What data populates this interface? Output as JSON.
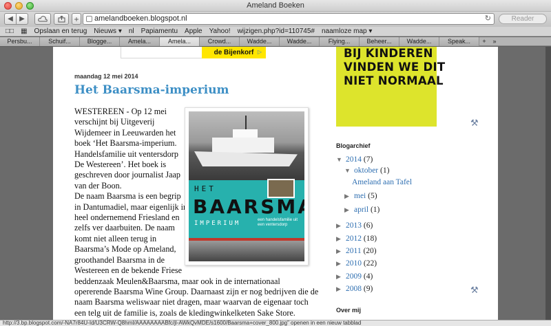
{
  "window": {
    "title": "Ameland Boeken"
  },
  "toolbar": {
    "back_icon": "◀",
    "forward_icon": "▶",
    "add_icon": "+",
    "url": "amelandboeken.blogspot.nl",
    "reload_icon": "↻",
    "reader_label": "Reader"
  },
  "bookmarks": {
    "items": [
      "Opslaan en terug",
      "Nieuws ▾",
      "nl",
      "Papiamentu",
      "Apple",
      "Yahoo!",
      "wijzigen.php?id=110745#",
      "naamloze map ▾"
    ]
  },
  "tabs": {
    "items": [
      "Persbu...",
      "Schuif...",
      "Blogge...",
      "Amela...",
      "Amela...",
      "Crowd...",
      "Wadde...",
      "Wadde...",
      "Flying...",
      "Beheer...",
      "Wadde...",
      "Speak..."
    ],
    "active_index": 4
  },
  "ad_top": {
    "brand": "de Bijenkorf",
    "choice_icon": "▷"
  },
  "post": {
    "date": "maandag 12 mei 2014",
    "title": "Het Baarsma-imperium",
    "paragraph1": "WESTEREEN - Op 12 mei verschijnt bij Uitgeverij Wijdemeer in Leeuwarden het boek ‘Het Baarsma-imperium. Handelsfamilie uit ventersdorp De Westereen’. Het boek is geschreven door journalist Jaap van der Boon.",
    "paragraph2": "De naam Baarsma is een begrip in Dantumadiel, maar eigenlijk in heel ondernemend Friesland en zelfs ver daarbuiten. De naam komt niet alleen terug in Baarsma’s Mode op Ameland, groothandel Baarsma in de Westereen en de bekende Friese beddenzaak Meulen&Baarsma, maar ook in de internationaal opererende Baarsma Wine Group. Daarnaast zijn er nog bedrijven die de naam Baarsma weliswaar niet dragen, maar waarvan de eigenaar toch een telg uit de familie is, zoals de kledingwinkelketen Sake Store."
  },
  "book_cover": {
    "het": "HET",
    "name": "BAARSMA",
    "imperium": "IMPERIUM",
    "subtitle": "een handelsfamilie uit een ventersdorp"
  },
  "sidebar": {
    "ad_lines": [
      "BIJ KINDEREN",
      "VINDEN WE DIT",
      "NIET NORMAAL"
    ],
    "archive_title": "Blogarchief",
    "archive": {
      "y2014": {
        "label": "2014",
        "count": "(7)"
      },
      "oktober": {
        "label": "oktober",
        "count": "(1)"
      },
      "oktober_post": "Ameland aan Tafel",
      "mei": {
        "label": "mei",
        "count": "(5)"
      },
      "april": {
        "label": "april",
        "count": "(1)"
      },
      "y2013": {
        "label": "2013",
        "count": "(6)"
      },
      "y2012": {
        "label": "2012",
        "count": "(18)"
      },
      "y2011": {
        "label": "2011",
        "count": "(20)"
      },
      "y2010": {
        "label": "2010",
        "count": "(22)"
      },
      "y2009": {
        "label": "2009",
        "count": "(4)"
      },
      "y2008": {
        "label": "2008",
        "count": "(9)"
      }
    },
    "about_title": "Over mij",
    "wrench_icon": "⚒"
  },
  "statusbar": {
    "text": "http://3.bp.blogspot.com/-NA7r84U-Id/U3CRW-Q8hmI/AAAAAAAABfc/jl-AWkQvMDE/s1600/Baarsma+cover_800.jpg” openen in een nieuw tabblad"
  }
}
